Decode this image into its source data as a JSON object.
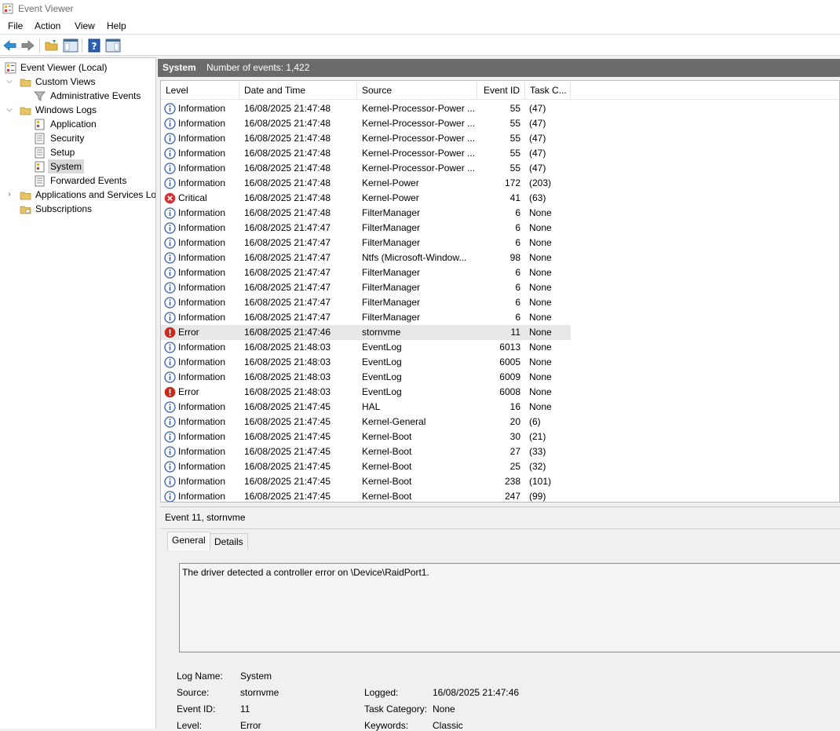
{
  "window": {
    "title": "Event Viewer"
  },
  "menu": [
    "File",
    "Action",
    "View",
    "Help"
  ],
  "tree": {
    "root": "Event Viewer (Local)",
    "custom_views": "Custom Views",
    "admin_events": "Administrative Events",
    "windows_logs": "Windows Logs",
    "application": "Application",
    "security": "Security",
    "setup": "Setup",
    "system": "System",
    "forwarded": "Forwarded Events",
    "apps_services": "Applications and Services Logs",
    "subscriptions": "Subscriptions"
  },
  "header": {
    "log_name": "System",
    "count_text": "Number of events: 1,422"
  },
  "columns": {
    "level": "Level",
    "datetime": "Date and Time",
    "source": "Source",
    "event_id": "Event ID",
    "task": "Task C..."
  },
  "events": [
    {
      "level": "Information",
      "datetime": "16/08/2025 21:47:48",
      "source": "Kernel-Processor-Power ...",
      "id": "55",
      "task": "(47)"
    },
    {
      "level": "Information",
      "datetime": "16/08/2025 21:47:48",
      "source": "Kernel-Processor-Power ...",
      "id": "55",
      "task": "(47)"
    },
    {
      "level": "Information",
      "datetime": "16/08/2025 21:47:48",
      "source": "Kernel-Processor-Power ...",
      "id": "55",
      "task": "(47)"
    },
    {
      "level": "Information",
      "datetime": "16/08/2025 21:47:48",
      "source": "Kernel-Processor-Power ...",
      "id": "55",
      "task": "(47)"
    },
    {
      "level": "Information",
      "datetime": "16/08/2025 21:47:48",
      "source": "Kernel-Processor-Power ...",
      "id": "55",
      "task": "(47)"
    },
    {
      "level": "Information",
      "datetime": "16/08/2025 21:47:48",
      "source": "Kernel-Power",
      "id": "172",
      "task": "(203)"
    },
    {
      "level": "Critical",
      "datetime": "16/08/2025 21:47:48",
      "source": "Kernel-Power",
      "id": "41",
      "task": "(63)"
    },
    {
      "level": "Information",
      "datetime": "16/08/2025 21:47:48",
      "source": "FilterManager",
      "id": "6",
      "task": "None"
    },
    {
      "level": "Information",
      "datetime": "16/08/2025 21:47:47",
      "source": "FilterManager",
      "id": "6",
      "task": "None"
    },
    {
      "level": "Information",
      "datetime": "16/08/2025 21:47:47",
      "source": "FilterManager",
      "id": "6",
      "task": "None"
    },
    {
      "level": "Information",
      "datetime": "16/08/2025 21:47:47",
      "source": "Ntfs (Microsoft-Window...",
      "id": "98",
      "task": "None"
    },
    {
      "level": "Information",
      "datetime": "16/08/2025 21:47:47",
      "source": "FilterManager",
      "id": "6",
      "task": "None"
    },
    {
      "level": "Information",
      "datetime": "16/08/2025 21:47:47",
      "source": "FilterManager",
      "id": "6",
      "task": "None"
    },
    {
      "level": "Information",
      "datetime": "16/08/2025 21:47:47",
      "source": "FilterManager",
      "id": "6",
      "task": "None"
    },
    {
      "level": "Information",
      "datetime": "16/08/2025 21:47:47",
      "source": "FilterManager",
      "id": "6",
      "task": "None"
    },
    {
      "level": "Error",
      "datetime": "16/08/2025 21:47:46",
      "source": "stornvme",
      "id": "11",
      "task": "None"
    },
    {
      "level": "Information",
      "datetime": "16/08/2025 21:48:03",
      "source": "EventLog",
      "id": "6013",
      "task": "None"
    },
    {
      "level": "Information",
      "datetime": "16/08/2025 21:48:03",
      "source": "EventLog",
      "id": "6005",
      "task": "None"
    },
    {
      "level": "Information",
      "datetime": "16/08/2025 21:48:03",
      "source": "EventLog",
      "id": "6009",
      "task": "None"
    },
    {
      "level": "Error",
      "datetime": "16/08/2025 21:48:03",
      "source": "EventLog",
      "id": "6008",
      "task": "None"
    },
    {
      "level": "Information",
      "datetime": "16/08/2025 21:47:45",
      "source": "HAL",
      "id": "16",
      "task": "None"
    },
    {
      "level": "Information",
      "datetime": "16/08/2025 21:47:45",
      "source": "Kernel-General",
      "id": "20",
      "task": "(6)"
    },
    {
      "level": "Information",
      "datetime": "16/08/2025 21:47:45",
      "source": "Kernel-Boot",
      "id": "30",
      "task": "(21)"
    },
    {
      "level": "Information",
      "datetime": "16/08/2025 21:47:45",
      "source": "Kernel-Boot",
      "id": "27",
      "task": "(33)"
    },
    {
      "level": "Information",
      "datetime": "16/08/2025 21:47:45",
      "source": "Kernel-Boot",
      "id": "25",
      "task": "(32)"
    },
    {
      "level": "Information",
      "datetime": "16/08/2025 21:47:45",
      "source": "Kernel-Boot",
      "id": "238",
      "task": "(101)"
    },
    {
      "level": "Information",
      "datetime": "16/08/2025 21:47:45",
      "source": "Kernel-Boot",
      "id": "247",
      "task": "(99)"
    }
  ],
  "selected_row": 15,
  "detail": {
    "title": "Event 11, stornvme",
    "tabs": {
      "general": "General",
      "details": "Details"
    },
    "message": "The driver detected a controller error on \\Device\\RaidPort1.",
    "labels": {
      "log_name": "Log Name:",
      "source": "Source:",
      "event_id": "Event ID:",
      "level": "Level:",
      "logged": "Logged:",
      "task_category": "Task Category:",
      "keywords": "Keywords:"
    },
    "values": {
      "log_name": "System",
      "source": "stornvme",
      "event_id": "11",
      "level": "Error",
      "logged": "16/08/2025 21:47:46",
      "task_category": "None",
      "keywords": "Classic"
    }
  },
  "colors": {
    "header_bg": "#6b6b6b",
    "info_blue": "#3b5f9e",
    "error_red": "#c42b1c",
    "critical_red": "#d13438"
  }
}
